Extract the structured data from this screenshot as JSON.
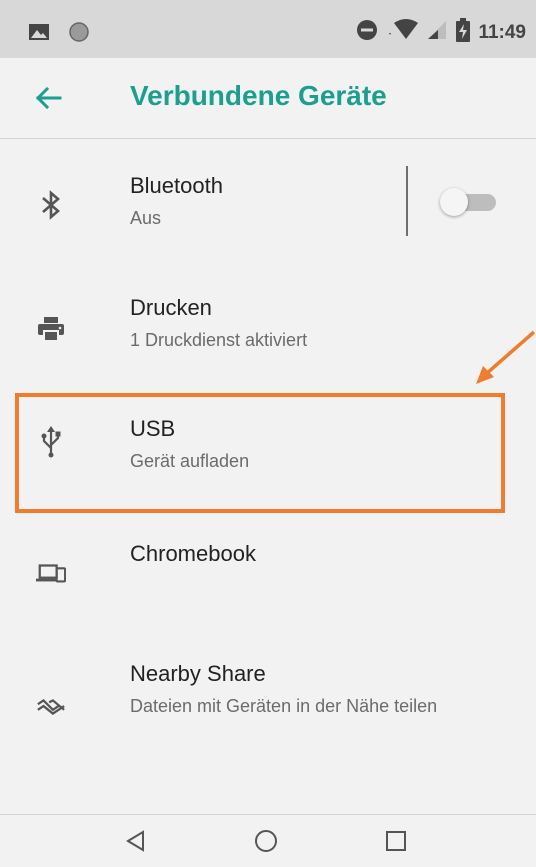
{
  "status_bar": {
    "time": "11:49",
    "icons": [
      "image-icon",
      "circle-icon",
      "do-not-disturb-icon",
      "wifi-icon",
      "signal-icon",
      "battery-charging-icon"
    ]
  },
  "app_bar": {
    "back_icon": "arrow-left-icon",
    "title": "Verbundene Geräte"
  },
  "items": [
    {
      "icon": "bluetooth-icon",
      "title": "Bluetooth",
      "subtitle": "Aus",
      "toggle_on": false
    },
    {
      "icon": "printer-icon",
      "title": "Drucken",
      "subtitle": "1 Druckdienst aktiviert"
    },
    {
      "icon": "usb-icon",
      "title": "USB",
      "subtitle": "Gerät aufladen"
    },
    {
      "icon": "laptop-phone-icon",
      "title": "Chromebook",
      "subtitle": ""
    },
    {
      "icon": "nearby-share-icon",
      "title": "Nearby Share",
      "subtitle": "Dateien mit Geräten in der Nähe teilen"
    }
  ],
  "annotation": {
    "color": "#ee7d2f",
    "target": "USB"
  },
  "colors": {
    "accent": "#1b9f8f",
    "background": "#f2f2f2",
    "statusbar": "#d8d8d8"
  },
  "nav_bar": {
    "icons": [
      "back-triangle-icon",
      "home-circle-icon",
      "recents-square-icon"
    ]
  }
}
